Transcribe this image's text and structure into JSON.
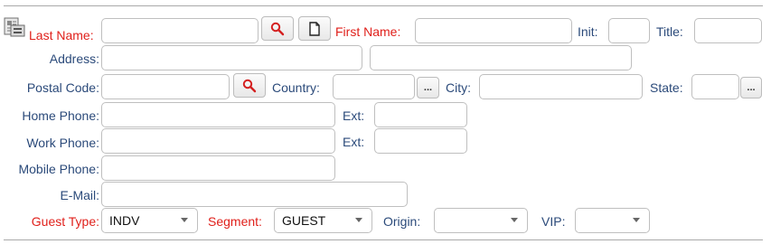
{
  "labels": {
    "last_name": "Last Name:",
    "first_name": "First Name:",
    "init": "Init:",
    "title": "Title:",
    "address": "Address:",
    "postal_code": "Postal Code:",
    "country": "Country:",
    "city": "City:",
    "state": "State:",
    "home_phone": "Home Phone:",
    "ext": "Ext:",
    "work_phone": "Work Phone:",
    "mobile_phone": "Mobile Phone:",
    "email": "E-Mail:",
    "guest_type": "Guest Type:",
    "segment": "Segment:",
    "origin": "Origin:",
    "vip": "VIP:"
  },
  "buttons": {
    "ellipsis": "..."
  },
  "fields": {
    "last_name": "",
    "first_name": "",
    "init": "",
    "title": "",
    "address_1": "",
    "address_2": "",
    "postal_code": "",
    "country": "",
    "city": "",
    "state": "",
    "home_phone": "",
    "home_ext": "",
    "work_phone": "",
    "work_ext": "",
    "mobile_phone": "",
    "email": ""
  },
  "selects": {
    "guest_type": "INDV",
    "segment": "GUEST",
    "origin": "",
    "vip": ""
  },
  "icons": {
    "profile": "profile-card-icon",
    "search": "search-icon",
    "new_document": "new-document-icon"
  },
  "colors": {
    "required_label": "#e0201b",
    "label": "#2b4a7a",
    "search_icon": "#d42020"
  }
}
